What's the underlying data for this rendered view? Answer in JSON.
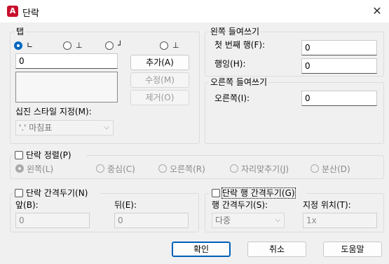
{
  "window": {
    "title": "단락",
    "app_icon": "A",
    "close_symbol": "✕"
  },
  "tabs_group": {
    "legend": "탭",
    "tab_types": [
      {
        "glyph": "∟",
        "selected": true
      },
      {
        "glyph": "⊥",
        "selected": false
      },
      {
        "glyph": "┘",
        "selected": false
      },
      {
        "glyph": "⊥",
        "selected": false
      }
    ],
    "position_value": "0",
    "buttons": {
      "add": "추가(A)",
      "modify": "수정(M)",
      "remove": "제거(O)"
    },
    "style_label": "십진 스타일 지정(M):",
    "style_value": "'.' 마침표"
  },
  "left_indent": {
    "legend": "왼쪽 들여쓰기",
    "first_line_label": "첫 번째 행(F):",
    "first_line_value": "0",
    "hanging_label": "행잉(H):",
    "hanging_value": "0"
  },
  "right_indent": {
    "legend": "오른쪽 들여쓰기",
    "right_label": "오른쪽(I):",
    "right_value": "0"
  },
  "alignment": {
    "checkbox_label": "단락 정렬(P)",
    "options": [
      "왼쪽(L)",
      "중심(C)",
      "오른쪽(R)",
      "자리맞추기(J)",
      "분산(D)"
    ]
  },
  "spacing": {
    "checkbox_label": "단락 간격두기(N)",
    "before_label": "앞(B):",
    "before_value": "0",
    "after_label": "뒤(E):",
    "after_value": "0"
  },
  "line_spacing": {
    "checkbox_label": "단락 행 간격두기(G)",
    "spacing_label": "행 간격두기(S):",
    "spacing_value": "다중",
    "at_label": "지정 위치(T):",
    "at_value": "1x"
  },
  "footer": {
    "ok": "확인",
    "cancel": "취소",
    "help": "도움말"
  },
  "colors": {
    "accent": "#0067c0",
    "app_icon_bg": "#c8102e"
  }
}
